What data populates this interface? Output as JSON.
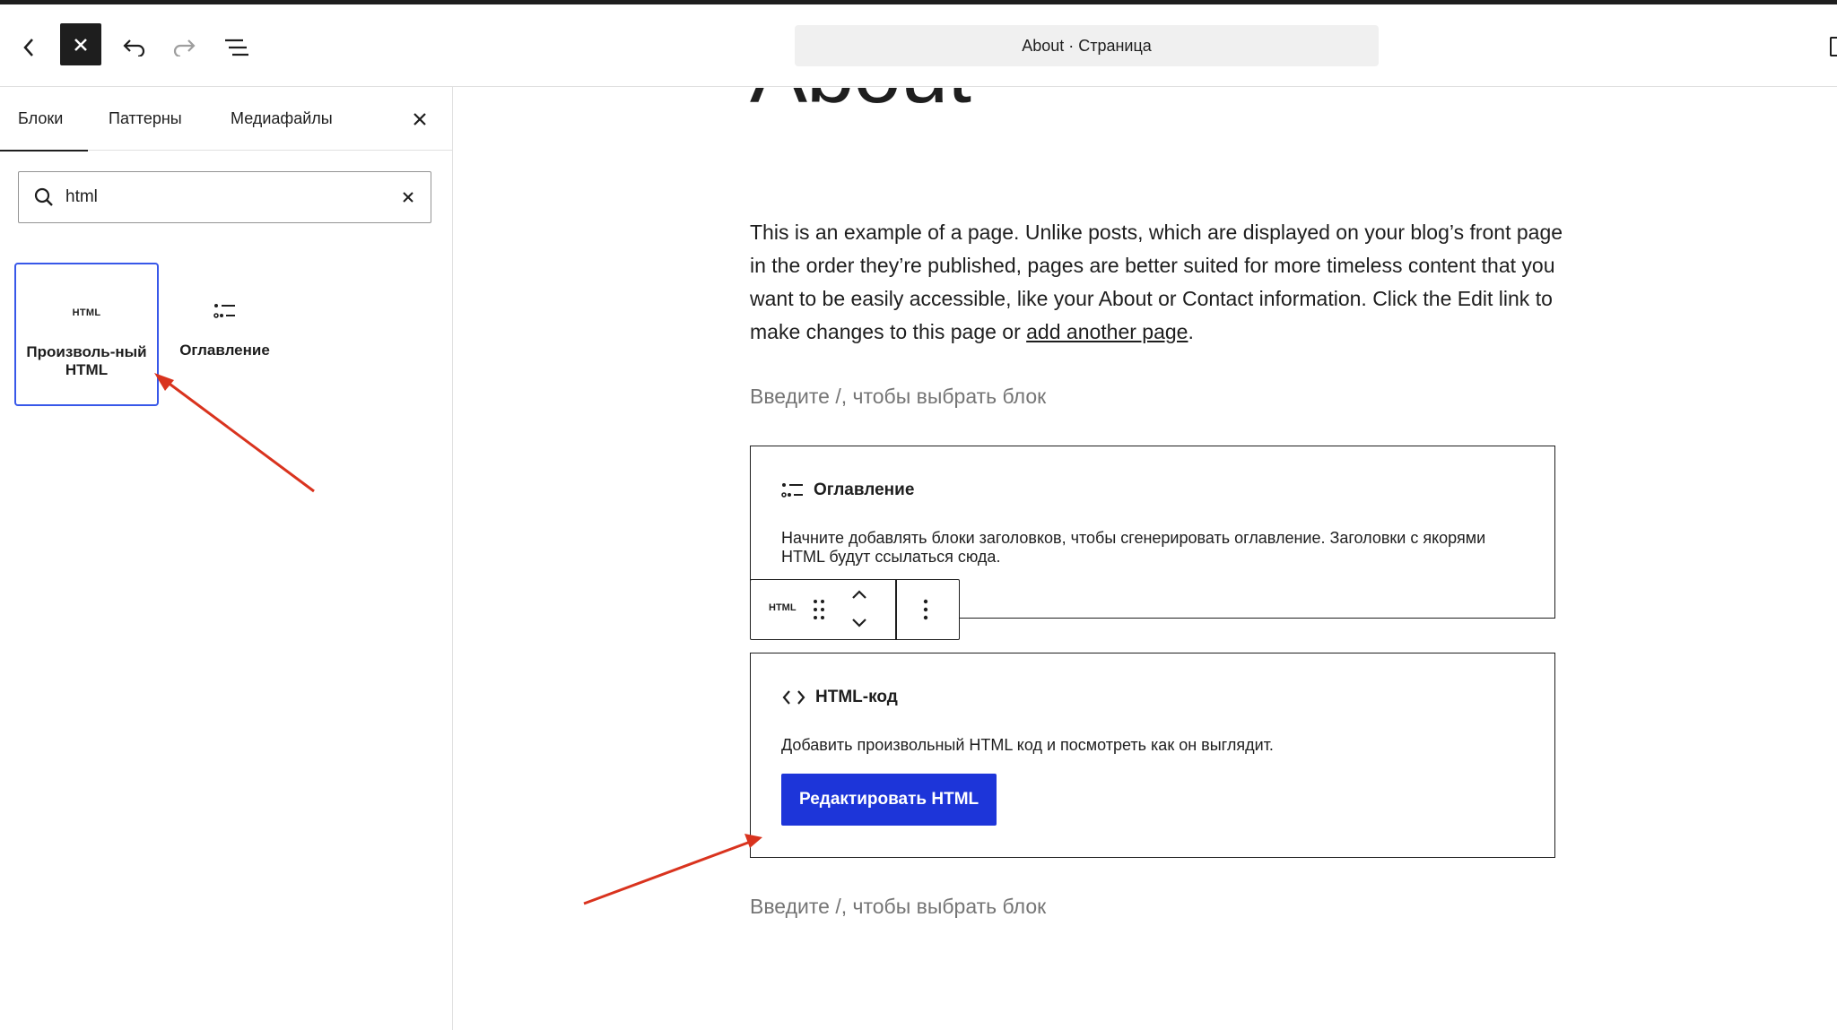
{
  "header": {
    "document_title": "About · Страница"
  },
  "sidebar": {
    "tabs": [
      {
        "label": "Блоки"
      },
      {
        "label": "Паттерны"
      },
      {
        "label": "Медиафайлы"
      }
    ],
    "search": {
      "value": "html",
      "placeholder": ""
    },
    "results": [
      {
        "icon_text": "HTML",
        "label": "Произволь-ный HTML",
        "icon": "html-icon"
      },
      {
        "label": "Оглавление",
        "icon": "table-of-contents-icon"
      }
    ]
  },
  "canvas": {
    "page_title": "About",
    "paragraph_text": "This is an example of a page. Unlike posts, which are displayed on your blog’s front page in the order they’re published, pages are better suited for more timeless content that you want to be easily accessible, like your About or Contact information. Click the Edit link to make changes to this page or ",
    "paragraph_link": "add another page",
    "paragraph_end": ".",
    "placeholder_1": "Введите /, чтобы выбрать блок",
    "placeholder_2": "Введите /, чтобы выбрать блок",
    "toc_block": {
      "title": "Оглавление",
      "description": "Начните добавлять блоки заголовков, чтобы сгенерировать оглавление. Заголовки с якорями HTML будут ссылаться сюда."
    },
    "block_toolbar": {
      "type_label": "HTML"
    },
    "html_block": {
      "title": "HTML-код",
      "description": "Добавить произвольный HTML код и посмотреть как он выглядит.",
      "button_label": "Редактировать HTML"
    }
  },
  "colors": {
    "accent": "#3858e9",
    "button": "#1d35d9",
    "annotation_arrow": "#d9331e",
    "placeholder": "#757575"
  }
}
